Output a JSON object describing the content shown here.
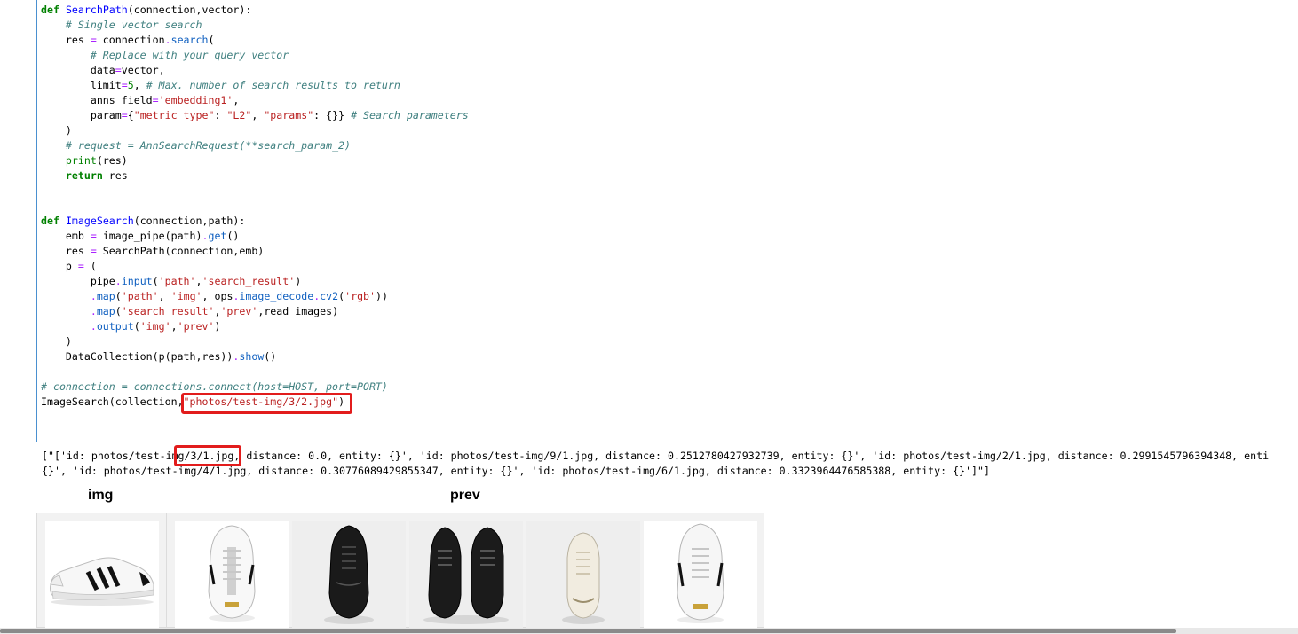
{
  "code_lines": [
    "def SearchPath(connection,vector):",
    "    # Single vector search",
    "    res = connection.search(",
    "        # Replace with your query vector",
    "        data=vector,",
    "        limit=5, # Max. number of search results to return",
    "        anns_field='embedding1',",
    "        param={\"metric_type\": \"L2\", \"params\": {}} # Search parameters",
    "    )",
    "    # request = AnnSearchRequest(**search_param_2)",
    "    print(res)",
    "    return res",
    "",
    "",
    "def ImageSearch(connection,path):",
    "    emb = image_pipe(path).get()",
    "    res = SearchPath(connection,emb)",
    "    p = (",
    "        pipe.input('path','search_result')",
    "        .map('path', 'img', ops.image_decode.cv2('rgb'))",
    "        .map('search_result','prev',read_images)",
    "        .output('img','prev')",
    "    )",
    "    DataCollection(p(path,res)).show()",
    "",
    "# connection = connections.connect(host=HOST, port=PORT)",
    "ImageSearch(collection,\"photos/test-img/3/2.jpg\")"
  ],
  "output_lines": [
    "[\"['id: photos/test-img/3/1.jpg, distance: 0.0, entity: {}', 'id: photos/test-img/9/1.jpg, distance: 0.2512780427932739, entity: {}', 'id: photos/test-img/2/1.jpg, distance: 0.2991545796394348, enti",
    "{}', 'id: photos/test-img/4/1.jpg, distance: 0.30776089429855347, entity: {}', 'id: photos/test-img/6/1.jpg, distance: 0.3323964476585388, entity: {}']\"]"
  ],
  "result_table": {
    "columns": [
      "img",
      "prev"
    ],
    "img_thumbs": [
      "white-sneaker-side"
    ],
    "prev_thumbs": [
      "white-sneaker-top",
      "black-runner-top",
      "black-runner-pair-top",
      "cream-sneaker-top",
      "white-sneaker-top-2"
    ]
  },
  "highlight_color": "#e21c1c"
}
